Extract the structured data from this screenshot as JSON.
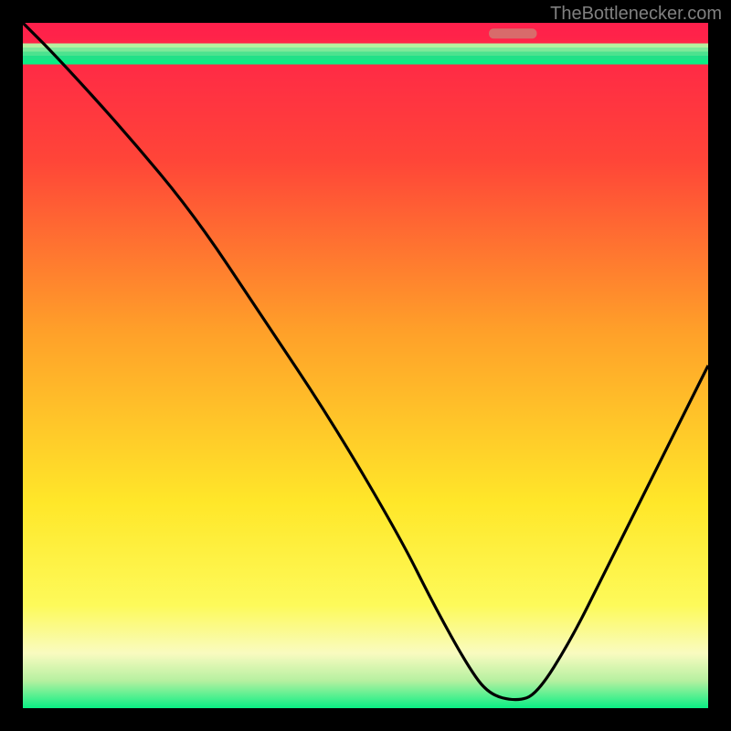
{
  "watermark": "TheBottlenecker.com",
  "chart_data": {
    "type": "line",
    "title": "",
    "xlabel": "",
    "ylabel": "",
    "xlim": [
      0,
      100
    ],
    "ylim": [
      0,
      100
    ],
    "gradient_stops": [
      {
        "offset": 0,
        "color": "#ff1f4b"
      },
      {
        "offset": 20,
        "color": "#ff4538"
      },
      {
        "offset": 45,
        "color": "#ffa029"
      },
      {
        "offset": 70,
        "color": "#ffe729"
      },
      {
        "offset": 85,
        "color": "#fdfa5a"
      },
      {
        "offset": 92,
        "color": "#f9fbc0"
      },
      {
        "offset": 96,
        "color": "#b6f0a0"
      },
      {
        "offset": 100,
        "color": "#09ef84"
      }
    ],
    "green_band": {
      "y_from": 97,
      "y_to": 100,
      "color": "#09ef84"
    },
    "curve": {
      "description": "Bottleneck severity curve; dips to zero near optimal point",
      "x": [
        0,
        5,
        15,
        25,
        35,
        45,
        55,
        60,
        65,
        68,
        72,
        75,
        80,
        85,
        90,
        95,
        100
      ],
      "y": [
        100,
        95,
        84,
        72,
        57,
        42,
        25,
        15,
        6,
        2,
        1,
        2,
        10,
        20,
        30,
        40,
        50
      ]
    },
    "optimal_marker": {
      "x_from": 68,
      "x_to": 75,
      "y": 98.5,
      "color": "#d86b6b"
    }
  }
}
